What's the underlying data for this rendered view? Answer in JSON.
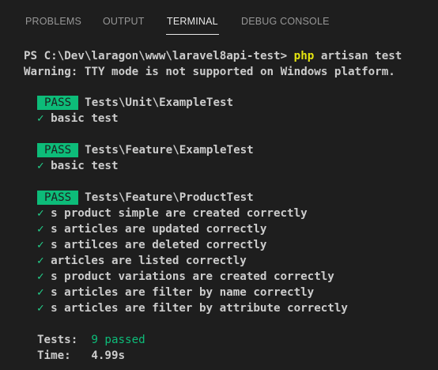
{
  "tabs": [
    {
      "label": "PROBLEMS",
      "active": false
    },
    {
      "label": "OUTPUT",
      "active": false
    },
    {
      "label": "TERMINAL",
      "active": true
    },
    {
      "label": "DEBUG CONSOLE",
      "active": false
    }
  ],
  "terminal": {
    "prompt": "PS C:\\Dev\\laragon\\www\\laravel8api-test> ",
    "command": "php",
    "command_args": " artisan test",
    "warning": "Warning: TTY mode is not supported on Windows platform.",
    "pass_label": "PASS",
    "check_glyph": "✓",
    "suites": [
      {
        "name": "Tests\\Unit\\ExampleTest",
        "cases": [
          "basic test"
        ]
      },
      {
        "name": "Tests\\Feature\\ExampleTest",
        "cases": [
          "basic test"
        ]
      },
      {
        "name": "Tests\\Feature\\ProductTest",
        "cases": [
          "s product simple are created correctly",
          "s articles are updated correctly",
          "s artilces are deleted correctly",
          "articles are listed correctly",
          "s product variations are created correctly",
          "s articles are filter by name correctly",
          "s articles are filter by attribute correctly"
        ]
      }
    ],
    "summary": {
      "tests_label": "Tests:",
      "tests_value": "9 passed",
      "time_label": "Time:",
      "time_value": "4.99s"
    }
  },
  "colors": {
    "background": "#1e1e1e",
    "pass_badge": "#0dbc79",
    "check": "#23d18b",
    "command": "#e5e510"
  }
}
